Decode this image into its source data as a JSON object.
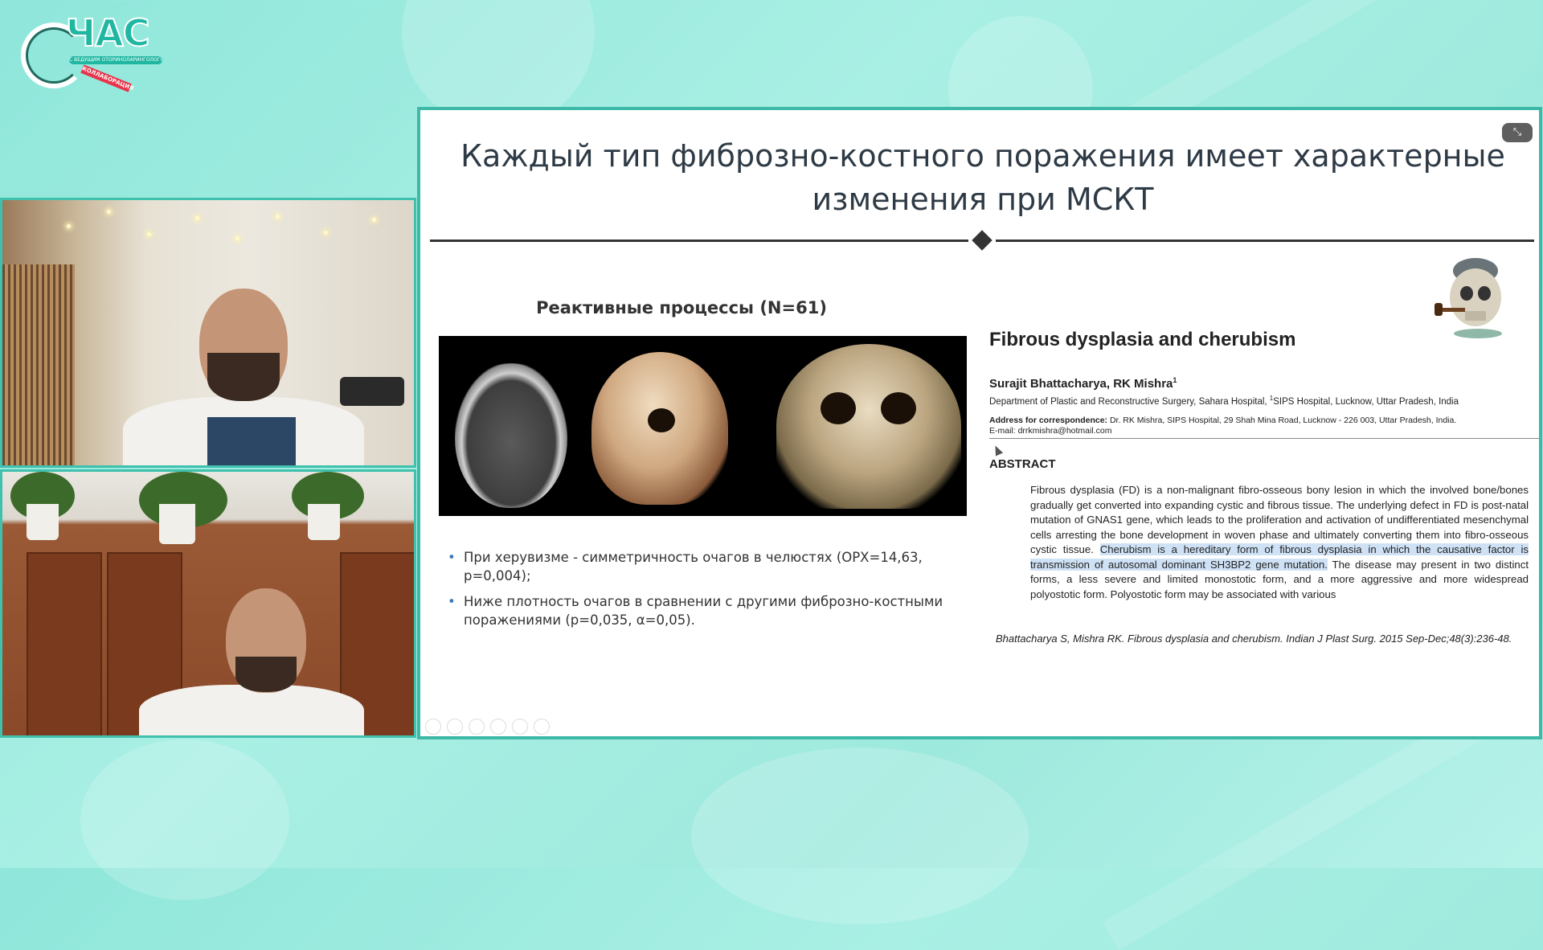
{
  "logo": {
    "word": "ЧАС",
    "subline": "С ВЕДУЩИМ ОТОРИНОЛАРИНГОЛОГОМ",
    "tag": "КОЛЛАБОРАЦИЯ"
  },
  "slide": {
    "title_line1": "Каждый тип фиброзно-костного поражения имеет характерные",
    "title_line2": "изменения при МСКТ",
    "subheading": "Реактивные процессы (N=61)",
    "bullets": [
      "При херувизме - симметричность очагов в челюстях (ОРХ=14,63, р=0,004);",
      "Ниже плотность очагов в сравнении с другими фиброзно-костными поражениями (р=0,035, α=0,05)."
    ],
    "paper": {
      "title": "Fibrous dysplasia and cherubism",
      "authors": "Surajit Bhattacharya, RK Mishra",
      "authors_sup": "1",
      "department": "Department of Plastic and Reconstructive Surgery, Sahara Hospital, ",
      "department_sup": "1",
      "department_tail": "SIPS Hospital, Lucknow, Uttar Pradesh, India",
      "address_label": "Address for correspondence:",
      "address_text": " Dr. RK Mishra, SIPS Hospital, 29 Shah Mina Road, Lucknow - 226 003, Uttar Pradesh, India.",
      "email": "E-mail: drrkmishra@hotmail.com",
      "abstract_heading": "ABSTRACT",
      "abstract_pre": "Fibrous dysplasia (FD) is a non-malignant fibro-osseous bony lesion in which the involved bone/bones gradually get converted into expanding cystic and fibrous tissue. The underlying defect in FD is post-natal mutation of GNAS1 gene, which leads to the proliferation and activation of undifferentiated mesenchymal cells arresting the bone development in woven phase and ultimately converting them into fibro-osseous cystic tissue. ",
      "abstract_highlight": "Cherubism is a hereditary form of fibrous dysplasia in which the causative factor is transmission of autosomal dominant SH3BP2 gene mutation.",
      "abstract_post": " The disease may present in two distinct forms, a less severe and limited monostotic form, and a more aggressive and more widespread polyostotic form. Polyostotic form may be associated with various"
    },
    "citation": "Bhattacharya S, Mishra RK. Fibrous dysplasia and cherubism. Indian J Plast Surg. 2015 Sep-Dec;48(3):236-48.",
    "minimize_icon": "minimize-icon"
  },
  "colors": {
    "accent": "#3fb9a7",
    "brand": "#1fb7a1",
    "tag": "#e8344a"
  }
}
